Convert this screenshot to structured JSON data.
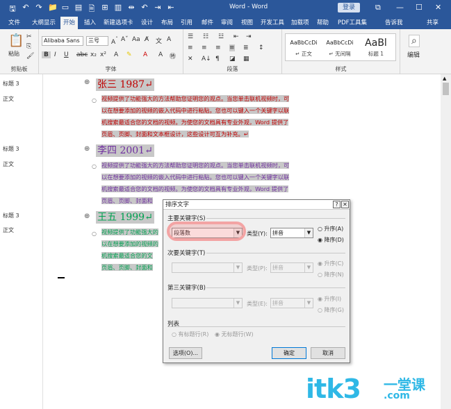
{
  "titlebar": {
    "title": "Word - Word",
    "login": "登录",
    "qat": [
      "🖫",
      "↶",
      "↷",
      "📁",
      "▭",
      "▤",
      "🖹",
      "⊞",
      "▥",
      "⇹",
      "↶",
      "⇥",
      "⇤"
    ],
    "min": "—",
    "max": "☐",
    "close": "✕",
    "restore": "⧉"
  },
  "tabs": [
    "文件",
    "大纲显示",
    "开始",
    "插入",
    "新建选项卡",
    "设计",
    "布局",
    "引用",
    "邮件",
    "审阅",
    "视图",
    "开发工具",
    "加载项",
    "帮助",
    "PDF工具集",
    "告诉我",
    "共享"
  ],
  "ribbon": {
    "paste": "粘贴",
    "clipboard": "剪贴板",
    "font_name": "Alibaba Sans",
    "font_size": "三号",
    "font_group": "字体",
    "para_group": "段落",
    "styles_group": "样式",
    "edit": "编辑",
    "styles": [
      {
        "preview": "AaBbCcDi",
        "name": "↵ 正文"
      },
      {
        "preview": "AaBbCcDi",
        "name": "↵ 无间隔"
      },
      {
        "preview": "AaBl",
        "name": "标题 1"
      }
    ]
  },
  "leftpane": {
    "labels": [
      "标题 3",
      "正文",
      "标题 3",
      "正文",
      "标题 3",
      "正文"
    ]
  },
  "document": {
    "headings": [
      {
        "text": "张三 1987↵",
        "color": "#c00000"
      },
      {
        "text": "李四 2001↵",
        "color": "#7030a0"
      },
      {
        "text": "王五 1999↵",
        "color": "#00a050"
      }
    ],
    "para1": [
      "视频提供了功能强大的方法帮助您证明您的观点。当您单击联机视频时，可",
      "以在想要添加的视频的嵌入代码中进行粘贴。您也可以键入一个关键字以联",
      "机搜索最适合您的文档的视频。为使您的文档具有专业外观，Word 提供了",
      "页眉、页脚、封面和文本框设计，这些设计可互为补充。↵"
    ],
    "para2": [
      "视频提供了功能强大的方法帮助您证明您的观点。当您单击联机视频时，可",
      "以在想要添加的视频的嵌入代码中进行粘贴。您也可以键入一个关键字以联",
      "机搜索最适合您的文档的视频。为使您的文档具有专业外观，Word 提供了",
      "页眉、页脚、封面和"
    ],
    "para3": [
      "视频提供了功能强大的",
      "以在想要添加的视频的",
      "机搜索最适合您的文",
      "页眉、页脚、封面和"
    ]
  },
  "dialog": {
    "title": "排序文字",
    "help": "?",
    "close": "✕",
    "primary_label": "主要关键字(S)",
    "primary_value": "段落数",
    "type_label": "类型(Y):",
    "type_value": "拼音",
    "asc": "升序(A)",
    "desc": "降序(D)",
    "secondary_label": "次要关键字(T)",
    "type2_label": "类型(P):",
    "type2_value": "拼音",
    "asc2": "升序(C)",
    "desc2": "降序(N)",
    "third_label": "第三关键字(B)",
    "type3_label": "类型(E):",
    "type3_value": "拼音",
    "asc3": "升序(I)",
    "desc3": "降序(G)",
    "list_label": "列表",
    "has_header": "有标题行(R)",
    "no_header": "无标题行(W)",
    "options": "选项(O)...",
    "ok": "确定",
    "cancel": "取消"
  },
  "watermark": {
    "main": "itk3",
    "sub1": "一堂课",
    "sub2": ".com"
  }
}
